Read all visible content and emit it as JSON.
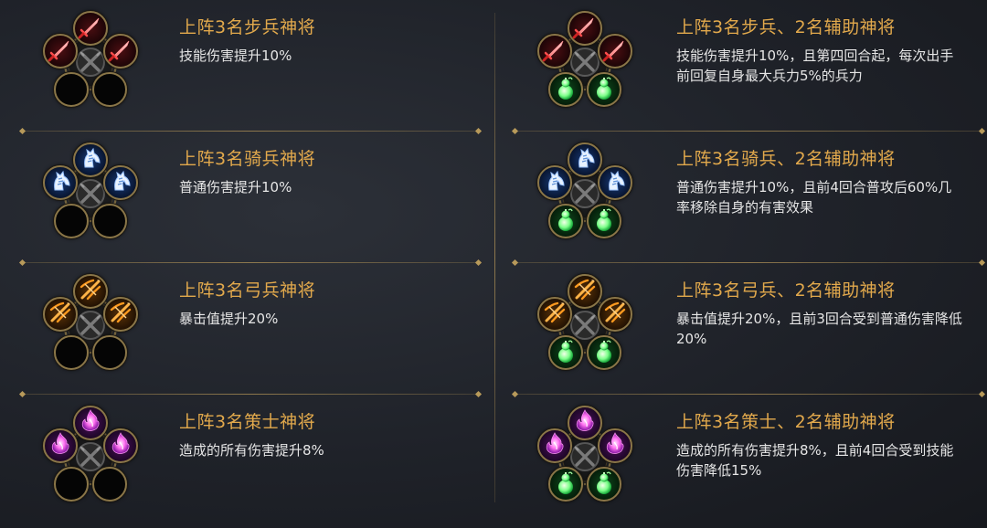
{
  "colors": {
    "title": "#e2a94c",
    "description": "#e6e6e6",
    "divider": "#b09256",
    "frame": "#8a7648"
  },
  "left_column": [
    {
      "title": "上阵3名步兵神将",
      "description": "技能伤害提升10%",
      "unit_icon": "sword-icon",
      "unit_theme": "red",
      "support": false
    },
    {
      "title": "上阵3名骑兵神将",
      "description": "普通伤害提升10%",
      "unit_icon": "horse-icon",
      "unit_theme": "blue",
      "support": false
    },
    {
      "title": "上阵3名弓兵神将",
      "description": "暴击值提升20%",
      "unit_icon": "crossbow-icon",
      "unit_theme": "orange",
      "support": false
    },
    {
      "title": "上阵3名策士神将",
      "description": "造成的所有伤害提升8%",
      "unit_icon": "magic-flame-icon",
      "unit_theme": "purple",
      "support": false
    }
  ],
  "right_column": [
    {
      "title": "上阵3名步兵、2名辅助神将",
      "description": "技能伤害提升10%，且第四回合起，每次出手前回复自身最大兵力5%的兵力",
      "unit_icon": "sword-icon",
      "unit_theme": "red",
      "support": true
    },
    {
      "title": "上阵3名骑兵、2名辅助神将",
      "description": "普通伤害提升10%，且前4回合普攻后60%几率移除自身的有害效果",
      "unit_icon": "horse-icon",
      "unit_theme": "blue",
      "support": true
    },
    {
      "title": "上阵3名弓兵、2名辅助神将",
      "description": "暴击值提升20%，且前3回合受到普通伤害降低20%",
      "unit_icon": "crossbow-icon",
      "unit_theme": "orange",
      "support": true
    },
    {
      "title": "上阵3名策士、2名辅助神将",
      "description": "造成的所有伤害提升8%，且前4回合受到技能伤害降低15%",
      "unit_icon": "magic-flame-icon",
      "unit_theme": "purple",
      "support": true
    }
  ],
  "support_icon": "gourd-icon"
}
